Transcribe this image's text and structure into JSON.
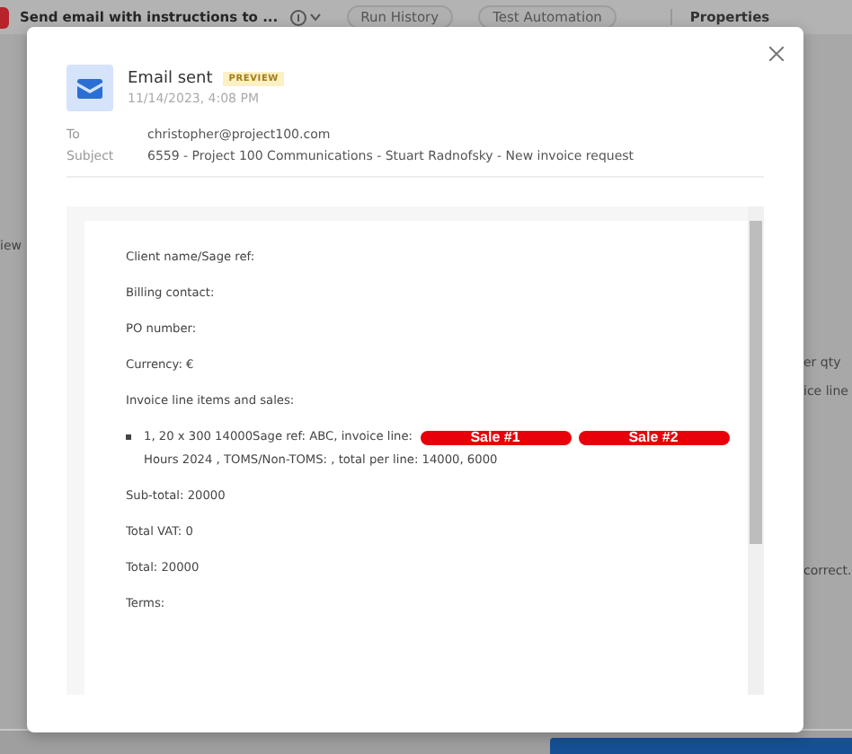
{
  "app_bar": {
    "title": "Send email with instructions to ...",
    "buttons": [
      "Run History",
      "Test Automation"
    ],
    "panel_title": "Properties"
  },
  "background_fragments": {
    "left": [
      "iew"
    ],
    "right": [
      "er qty",
      "ice line",
      "correct."
    ]
  },
  "modal": {
    "title": "Email sent",
    "badge": "PREVIEW",
    "timestamp": "11/14/2023, 4:08 PM",
    "fields": [
      {
        "label": "To",
        "value": "christopher@project100.com"
      },
      {
        "label": "Subject",
        "value": "6559 - Project 100 Communications - Stuart Radnofsky - New invoice request"
      }
    ],
    "body": [
      {
        "kind": "paragraph",
        "text": "Client name/Sage ref:"
      },
      {
        "kind": "paragraph",
        "text": "Billing contact:"
      },
      {
        "kind": "paragraph",
        "text": "PO number:"
      },
      {
        "kind": "paragraph",
        "text": "Currency: €"
      },
      {
        "kind": "paragraph",
        "text": "Invoice line items and sales:"
      },
      {
        "kind": "bullet",
        "text": "1, 20 x 300 14000Sage ref: ABC, invoice line:",
        "redactions": [
          "Sale #1",
          "Sale #2"
        ],
        "continuation": "Hours 2024 , TOMS/Non-TOMS: , total per line: 14000, 6000"
      },
      {
        "kind": "paragraph",
        "text": "Sub-total: 20000"
      },
      {
        "kind": "paragraph",
        "text": "Total VAT: 0"
      },
      {
        "kind": "paragraph",
        "text": "Total: 20000"
      },
      {
        "kind": "paragraph",
        "text": "Terms:"
      }
    ]
  }
}
